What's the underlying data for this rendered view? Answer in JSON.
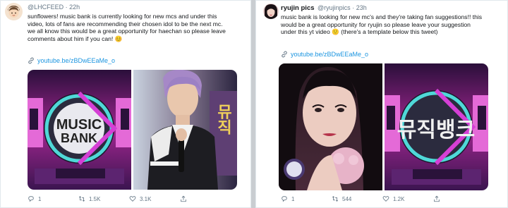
{
  "tweets": [
    {
      "username": "@LHCFEED",
      "time": "22h",
      "lines": [
        "sunflowers! music bank is currently looking for new mcs and under this",
        "video, lots of fans are recommending their chosen idol to be the next mc.",
        "we all know this would be a great opportunity for haechan so please leave",
        "comments about him if you can! 😊"
      ],
      "link": "youtube.be/zBDwEEaMe_o",
      "logo_text": [
        "MUSIC",
        "BANK"
      ],
      "side_text": "뮤직",
      "stats": {
        "replies": "1",
        "retweets": "1.5K",
        "likes": "3.1K"
      }
    },
    {
      "display_name": "ryujin pics",
      "username": "@ryujinpics",
      "time": "23h",
      "lines": [
        "music bank is looking for new mc's and they're taking fan suggestions!! this",
        "would be a great opportunity for ryujin so please leave your suggestion",
        "under this yt video 🙂 (there's a template below this tweet)"
      ],
      "link": "youtube.be/zBDwEEaMe_o",
      "logo_text": "뮤직뱅크",
      "stats": {
        "replies": "1",
        "retweets": "544",
        "likes": "1.2K"
      }
    }
  ],
  "colors": {
    "link": "#1b95e0",
    "meta": "#657786",
    "text": "#14171a",
    "magenta": "#d53fd5",
    "teal": "#4fd8d8"
  },
  "icons": [
    "reply-icon",
    "retweet-icon",
    "like-icon",
    "share-icon",
    "link-icon"
  ]
}
